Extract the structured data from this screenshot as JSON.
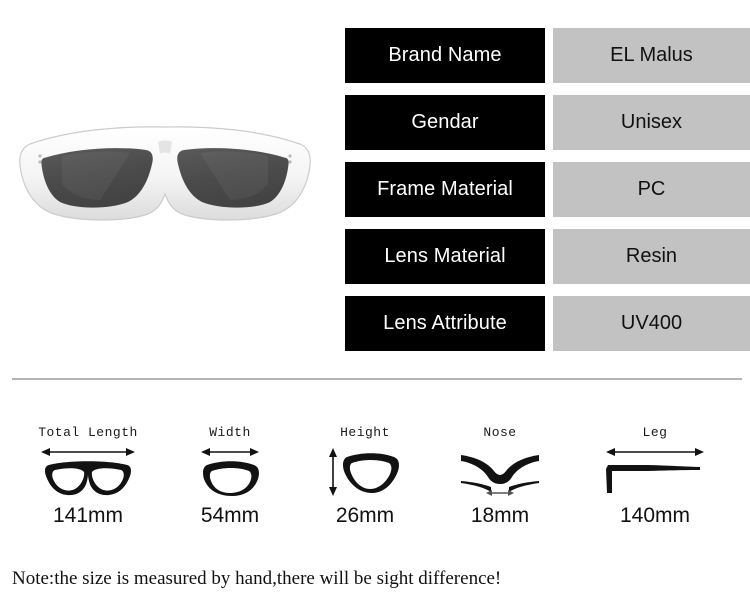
{
  "product_image": {
    "alt": "white-frame-wraparound-sunglasses",
    "frame_color": "#f2f2f2",
    "frame_shadow": "#cfcfcf",
    "lens_color": "#4a4a4a"
  },
  "spec_table": {
    "key_bg": "#000000",
    "key_fg": "#ffffff",
    "value_bg": "#c2c2c2",
    "value_fg": "#111111",
    "rows": [
      {
        "key": "Brand Name",
        "value": "EL Malus"
      },
      {
        "key": "Gendar",
        "value": "Unisex"
      },
      {
        "key": "Frame Material",
        "value": "PC"
      },
      {
        "key": "Lens Material",
        "value": "Resin"
      },
      {
        "key": "Lens Attribute",
        "value": "UV400"
      }
    ]
  },
  "divider": {
    "color": "#b4b4b4"
  },
  "measurements": [
    {
      "label": "Total Length",
      "value": "141mm",
      "icon": "glasses-front-icon"
    },
    {
      "label": "Width",
      "value": "54mm",
      "icon": "lens-width-icon"
    },
    {
      "label": "Height",
      "value": "26mm",
      "icon": "lens-height-icon"
    },
    {
      "label": "Nose",
      "value": "18mm",
      "icon": "nose-bridge-icon"
    },
    {
      "label": "Leg",
      "value": "140mm",
      "icon": "temple-leg-icon"
    }
  ],
  "footer": {
    "note": "Note:the size is measured by hand,there will be sight difference!"
  }
}
